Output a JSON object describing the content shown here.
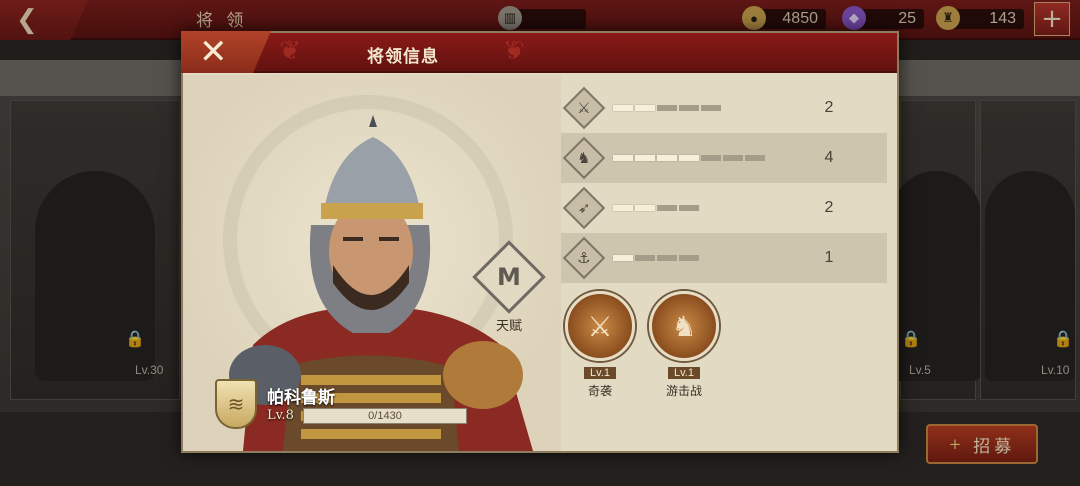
{
  "topbar": {
    "back_glyph": "❮",
    "title": "将 领",
    "resources": [
      {
        "icon": "temple-icon",
        "glyph": "▥",
        "value": "",
        "color": "#9c9488"
      },
      {
        "icon": "coin-icon",
        "glyph": "●",
        "value": "4850",
        "color": "#c9a24e"
      },
      {
        "icon": "gem-icon",
        "glyph": "◆",
        "value": "25",
        "color": "#8a56c8"
      },
      {
        "icon": "helmet-icon",
        "glyph": "♜",
        "value": "143",
        "color": "#c9a24e"
      }
    ],
    "plus_glyph": "+"
  },
  "background": {
    "left_card_level": "Lv.30",
    "right_card_levels": [
      "Lv.5",
      "Lv.10"
    ],
    "lock_glyph": "🔒"
  },
  "recruit_button": {
    "label": "招募",
    "icon": "+"
  },
  "modal": {
    "title": "将领信息",
    "close_glyph": "✕",
    "talent": {
      "label": "天赋",
      "glyph": "M"
    },
    "hero": {
      "name": "帕科鲁斯",
      "level": "Lv.8",
      "xp_text": "0/1430",
      "xp_fraction": 0.0,
      "rank_glyph": "≋"
    },
    "stats": [
      {
        "icon": "sword-icon",
        "glyph": "⚔",
        "pips_total": 5,
        "pips_on": 2,
        "value": "2"
      },
      {
        "icon": "horse-icon",
        "glyph": "♞",
        "pips_total": 7,
        "pips_on": 4,
        "value": "4"
      },
      {
        "icon": "bow-icon",
        "glyph": "➶",
        "pips_total": 4,
        "pips_on": 2,
        "value": "2"
      },
      {
        "icon": "anchor-icon",
        "glyph": "⚓",
        "pips_total": 4,
        "pips_on": 1,
        "value": "1"
      }
    ],
    "skills": [
      {
        "name": "奇袭",
        "level": "Lv.1",
        "glyph": "⚔"
      },
      {
        "name": "游击战",
        "level": "Lv.1",
        "glyph": "♞"
      }
    ]
  }
}
